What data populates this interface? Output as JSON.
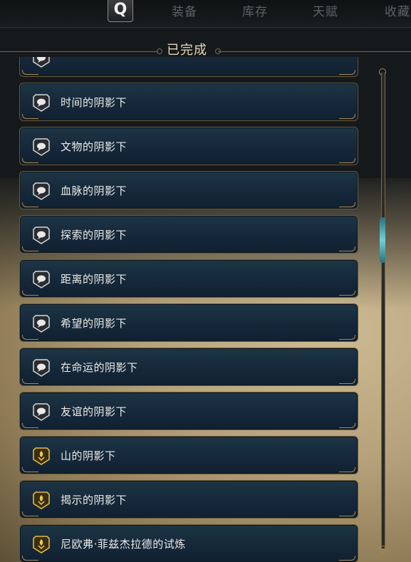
{
  "nav": {
    "q_key": "Q",
    "tabs": [
      "装备",
      "库存",
      "天赋",
      "收藏"
    ]
  },
  "section": {
    "title": "已完成"
  },
  "quests": [
    {
      "label": "",
      "icon": "speech-bubble-icon"
    },
    {
      "label": "时间的阴影下",
      "icon": "speech-bubble-icon"
    },
    {
      "label": "文物的阴影下",
      "icon": "speech-bubble-icon"
    },
    {
      "label": "血脉的阴影下",
      "icon": "speech-bubble-icon"
    },
    {
      "label": "探索的阴影下",
      "icon": "speech-bubble-icon"
    },
    {
      "label": "距离的阴影下",
      "icon": "speech-bubble-icon"
    },
    {
      "label": "希望的阴影下",
      "icon": "speech-bubble-icon"
    },
    {
      "label": "在命运的阴影下",
      "icon": "speech-bubble-icon"
    },
    {
      "label": "友谊的阴影下",
      "icon": "speech-bubble-icon"
    },
    {
      "label": "山的阴影下",
      "icon": "gold-crest-icon"
    },
    {
      "label": "揭示的阴影下",
      "icon": "gold-crest-icon"
    },
    {
      "label": "尼欧弗·菲兹杰拉德的试炼",
      "icon": "gold-crest-icon"
    }
  ],
  "colors": {
    "panel": "#15283a",
    "border_gold": "#a58a55",
    "scroll_accent": "#6fd1d9"
  }
}
